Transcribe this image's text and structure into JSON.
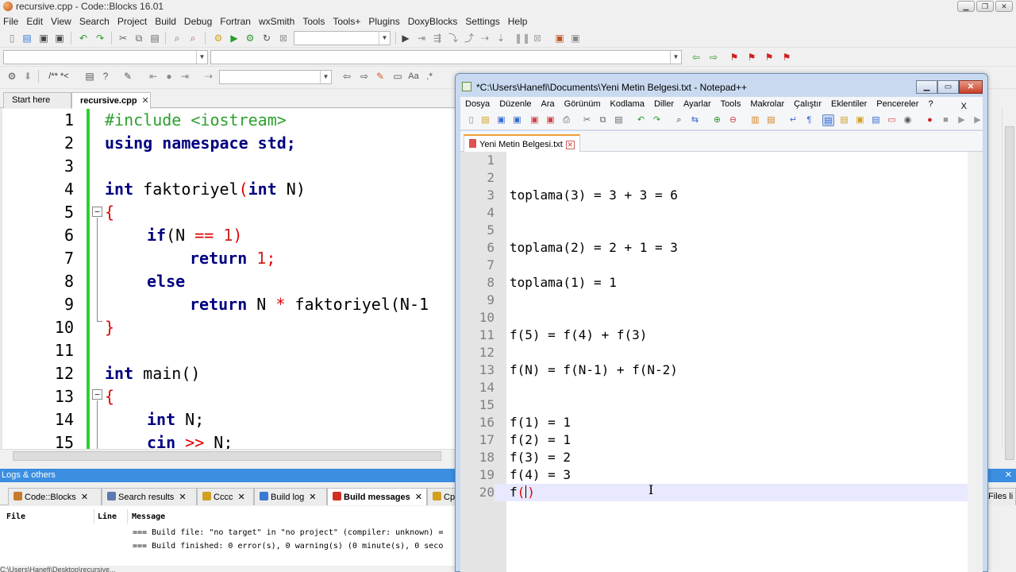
{
  "codeblocks": {
    "title": "recursive.cpp - Code::Blocks 16.01",
    "menu": [
      "File",
      "Edit",
      "View",
      "Search",
      "Project",
      "Build",
      "Debug",
      "Fortran",
      "wxSmith",
      "Tools",
      "Tools+",
      "Plugins",
      "DoxyBlocks",
      "Settings",
      "Help"
    ],
    "toolbar3_label": "/** *<",
    "tabs": [
      {
        "label": "Start here",
        "active": false
      },
      {
        "label": "recursive.cpp",
        "active": true
      }
    ],
    "code_lines": [
      {
        "n": "1",
        "text": ""
      },
      {
        "n": "2",
        "text": ""
      },
      {
        "n": "3",
        "text": ""
      },
      {
        "n": "4",
        "text": ""
      },
      {
        "n": "5",
        "text": ""
      },
      {
        "n": "6",
        "text": ""
      },
      {
        "n": "7",
        "text": ""
      },
      {
        "n": "8",
        "text": ""
      },
      {
        "n": "9",
        "text": ""
      },
      {
        "n": "10",
        "text": ""
      },
      {
        "n": "11",
        "text": ""
      },
      {
        "n": "12",
        "text": ""
      },
      {
        "n": "13",
        "text": ""
      },
      {
        "n": "14",
        "text": ""
      },
      {
        "n": "15",
        "text": ""
      }
    ],
    "code": {
      "l1": "#include <iostream>",
      "l2_kw": "using namespace",
      "l2_rest": " std;",
      "l4_kw": "int",
      "l4_fn": " faktoriyel",
      "l4_p1": "(",
      "l4_kw2": "int",
      "l4_rest": " N)",
      "brace_open": "{",
      "l6_kw": "if",
      "l6_a": "(N ",
      "l6_op": "==",
      "l6_num": " 1",
      "l6_b": ")",
      "l7_kw": "return",
      "l7_num": " 1",
      "l7_b": ";",
      "l8_kw": "else",
      "l9_kw": "return",
      "l9_a": " N ",
      "l9_op": "*",
      "l9_b": " faktoriyel(N-1",
      "brace_close": "}",
      "l12_kw": "int",
      "l12_rest": " main()",
      "l14_kw": "int",
      "l14_rest": " N;",
      "l15_kw": "cin",
      "l15_op": " >>",
      "l15_rest": " N;"
    },
    "logs": {
      "header": "Logs & others",
      "close": "✕",
      "tabs": [
        {
          "label": "Code::Blocks",
          "icon_color": "#c87a2a"
        },
        {
          "label": "Search results",
          "icon_color": "#5a7ab0"
        },
        {
          "label": "Cccc",
          "icon_color": "#d0a020"
        },
        {
          "label": "Build log",
          "icon_color": "#3a7ad0"
        },
        {
          "label": "Build messages",
          "icon_color": "#d03020",
          "active": true
        },
        {
          "label": "Cp",
          "icon_color": "#d0a020"
        },
        {
          "label": "Files li",
          "icon_color": "#888888"
        }
      ],
      "columns": {
        "file": "File",
        "line": "Line",
        "message": "Message"
      },
      "rows": [
        "=== Build file: \"no target\" in \"no project\" (compiler: unknown) =",
        "=== Build finished: 0 error(s), 0 warning(s) (0 minute(s), 0 seco"
      ]
    },
    "status": "C:\\Users\\Hanefi\\Desktop\\recursive..."
  },
  "notepad": {
    "title": "*C:\\Users\\Hanefi\\Documents\\Yeni Metin Belgesi.txt - Notepad++",
    "menu": [
      "Dosya",
      "Düzenle",
      "Ara",
      "Görünüm",
      "Kodlama",
      "Diller",
      "Ayarlar",
      "Tools",
      "Makrolar",
      "Çalıştır",
      "Eklentiler",
      "Pencereler",
      "?"
    ],
    "menu_close": "X",
    "tab": "Yeni Metin Belgesi.txt",
    "lines": [
      {
        "n": "1",
        "text": ""
      },
      {
        "n": "2",
        "text": ""
      },
      {
        "n": "3",
        "text": "toplama(3) = 3 + 3 = 6"
      },
      {
        "n": "4",
        "text": ""
      },
      {
        "n": "5",
        "text": ""
      },
      {
        "n": "6",
        "text": "toplama(2) = 2 + 1 = 3"
      },
      {
        "n": "7",
        "text": ""
      },
      {
        "n": "8",
        "text": "toplama(1) = 1"
      },
      {
        "n": "9",
        "text": ""
      },
      {
        "n": "10",
        "text": ""
      },
      {
        "n": "11",
        "text": "f(5) = f(4) + f(3)"
      },
      {
        "n": "12",
        "text": ""
      },
      {
        "n": "13",
        "text": "f(N) = f(N-1) + f(N-2)"
      },
      {
        "n": "14",
        "text": ""
      },
      {
        "n": "15",
        "text": ""
      },
      {
        "n": "16",
        "text": "f(1) = 1"
      },
      {
        "n": "17",
        "text": "f(2) = 1"
      },
      {
        "n": "18",
        "text": "f(3) = 2"
      },
      {
        "n": "19",
        "text": "f(4) = 3"
      },
      {
        "n": "20",
        "text": "f"
      }
    ],
    "last_open": "(",
    "last_close": ")"
  }
}
